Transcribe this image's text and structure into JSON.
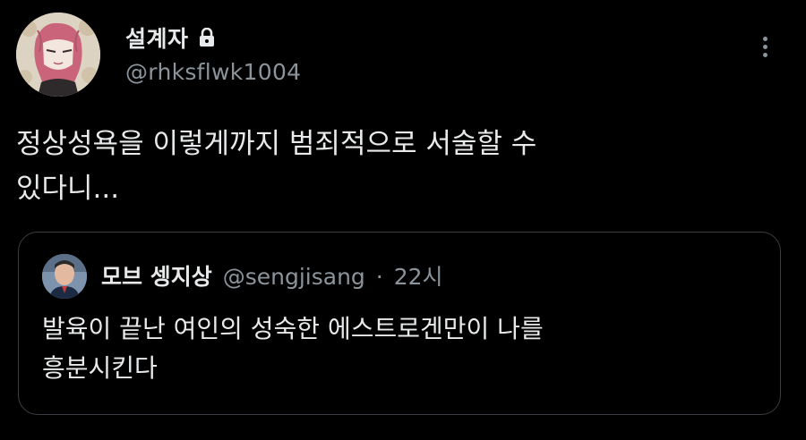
{
  "tweet": {
    "author": {
      "display_name": "설계자",
      "handle": "@rhksflwk1004",
      "protected_icon": "lock-icon",
      "avatar_icon": "profile-avatar"
    },
    "menu_icon": "more-vertical-icon",
    "text": "정상성욕을 이렇게까지 범죄적으로 서술할 수\n있다니...",
    "quote": {
      "author": {
        "display_name": "모브 셍지상",
        "handle": "@sengjisang",
        "separator": "·",
        "time": "22시",
        "avatar_icon": "profile-avatar"
      },
      "text": "발육이 끝난 여인의 성숙한 에스트로겐만이 나를\n흥분시킨다"
    }
  },
  "colors": {
    "background": "#000000",
    "primary_text": "#e7e9ea",
    "secondary_text": "#8b949a",
    "border": "#3a3d41"
  }
}
